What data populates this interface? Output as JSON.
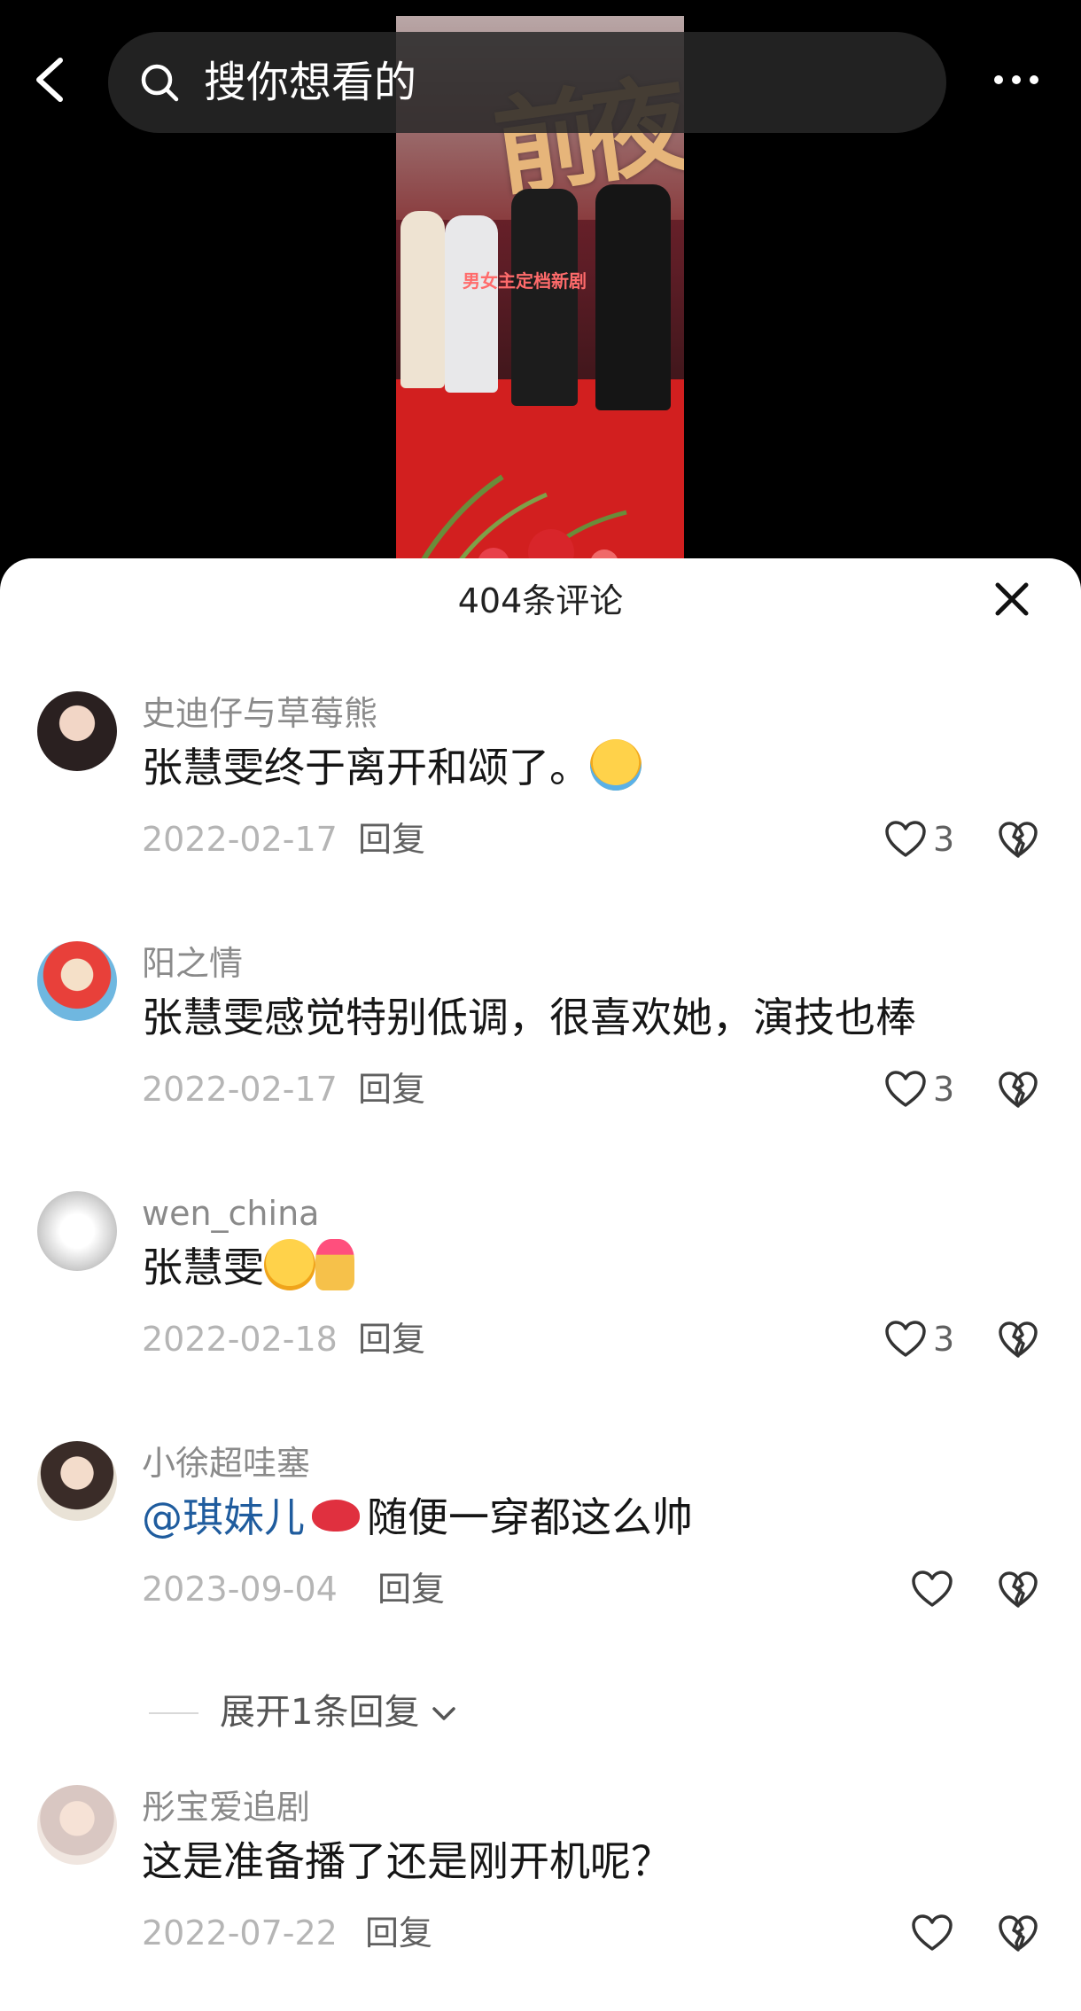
{
  "search": {
    "placeholder": "搜你想看的"
  },
  "video": {
    "poster_title": "前夜",
    "poster_subtitle": "男女主定档新剧"
  },
  "sheet": {
    "title": "404条评论"
  },
  "comments": [
    {
      "username": "史迪仔与草莓熊",
      "text": "张慧雯终于离开和颂了。",
      "emoji_after": "loudly-crying-face",
      "date": "2022-02-17",
      "reply_label": "回复",
      "likes": "3"
    },
    {
      "username": "阳之情",
      "text": "张慧雯感觉特别低调，很喜欢她，演技也棒",
      "date": "2022-02-17",
      "reply_label": "回复",
      "likes": "3"
    },
    {
      "username": "wen_china",
      "text": "张慧雯",
      "emoji_after": [
        "face-blowing-kiss",
        "heart-hands"
      ],
      "date": "2022-02-18",
      "reply_label": "回复",
      "likes": "3"
    },
    {
      "username": "小徐超哇塞",
      "mention": "@琪妹儿",
      "text": "随便一穿都这么帅",
      "emoji_after": "kiss-mark",
      "date": "2023-09-04",
      "reply_label": "回复",
      "likes": ""
    },
    {
      "username": "彤宝爱追剧",
      "text": "这是准备播了还是刚开机呢？",
      "date": "2022-07-22",
      "reply_label": "回复",
      "likes": ""
    }
  ],
  "expand_replies": "展开1条回复",
  "colors": {
    "mention": "#1f5c9e",
    "sheet_bg": "#ffffff",
    "top_bg": "#000000"
  }
}
